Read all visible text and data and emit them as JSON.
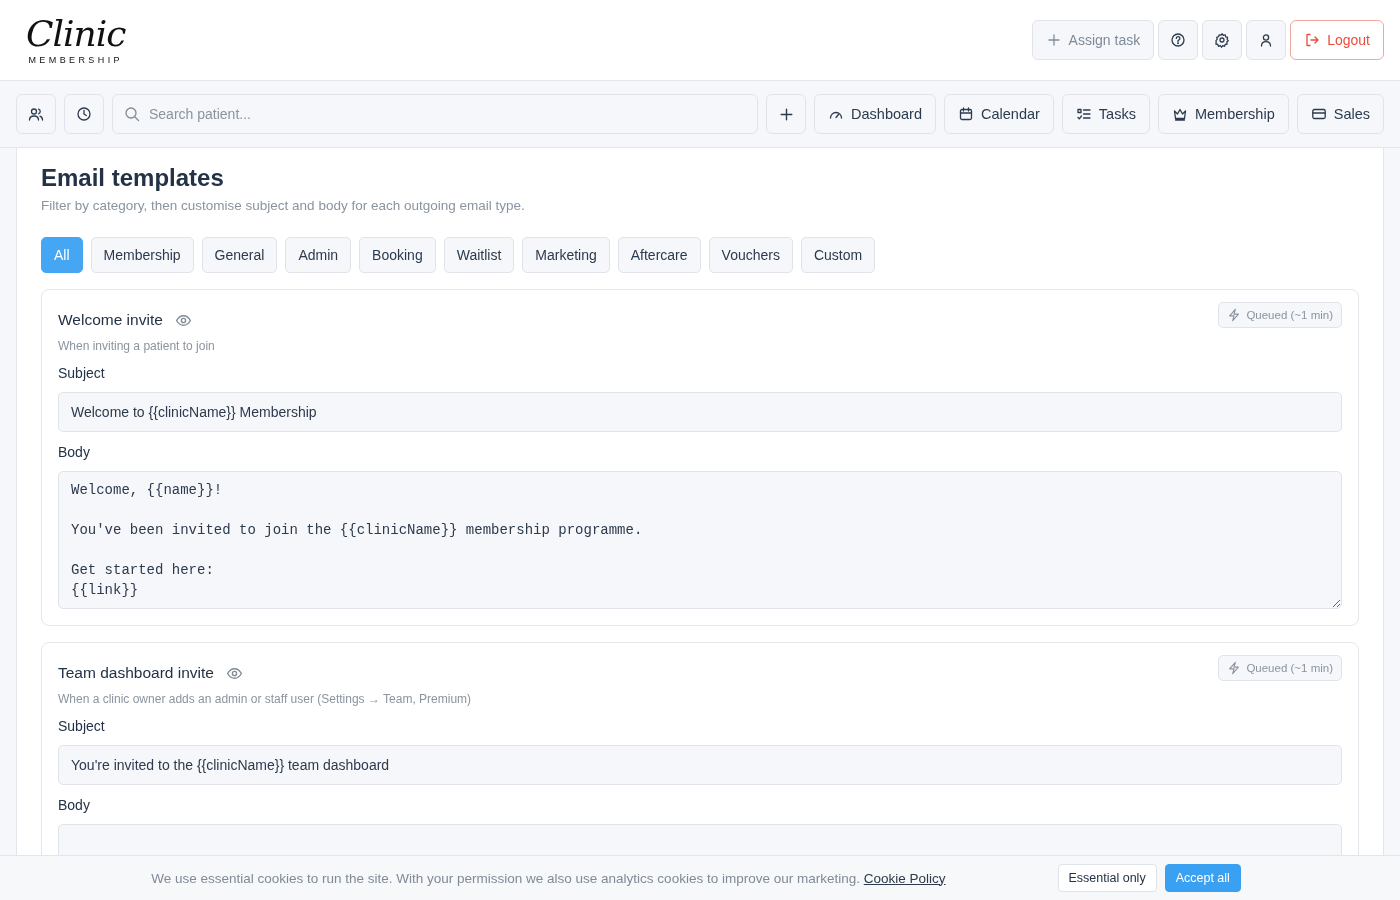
{
  "header": {
    "logo": {
      "script": "Clinic",
      "tagline": "MEMBERSHIP"
    },
    "actions": [
      {
        "kind": "assign",
        "label": "Assign task"
      },
      {
        "kind": "help"
      },
      {
        "kind": "settings"
      },
      {
        "kind": "account"
      },
      {
        "kind": "logout",
        "label": "Logout"
      }
    ]
  },
  "toolbar": {
    "left": [
      {
        "kind": "patients"
      },
      {
        "kind": "history"
      }
    ],
    "search": {
      "placeholder": "Search patient..."
    },
    "add": {
      "kind": "add"
    },
    "nav": [
      {
        "kind": "dashboard",
        "label": "Dashboard"
      },
      {
        "kind": "calendar",
        "label": "Calendar"
      },
      {
        "kind": "tasks",
        "label": "Tasks"
      },
      {
        "kind": "membership",
        "label": "Membership"
      },
      {
        "kind": "sales",
        "label": "Sales"
      }
    ]
  },
  "page": {
    "title": "Email templates",
    "subtitle": "Filter by category, then customise subject and body for each outgoing email type.",
    "filters": [
      {
        "label": "All",
        "selected": true
      },
      {
        "label": "Membership",
        "selected": false
      },
      {
        "label": "General",
        "selected": false
      },
      {
        "label": "Admin",
        "selected": false
      },
      {
        "label": "Booking",
        "selected": false
      },
      {
        "label": "Waitlist",
        "selected": false
      },
      {
        "label": "Marketing",
        "selected": false
      },
      {
        "label": "Aftercare",
        "selected": false
      },
      {
        "label": "Vouchers",
        "selected": false
      },
      {
        "label": "Custom",
        "selected": false
      }
    ],
    "templates": [
      {
        "name": "Welcome invite",
        "description": "When inviting a patient to join",
        "status": "Queued (~1 min)",
        "subject_label": "Subject",
        "subject": "Welcome to {{clinicName}} Membership",
        "body_label": "Body",
        "body": "Welcome, {{name}}!\n\nYou've been invited to join the {{clinicName}} membership programme.\n\nGet started here:\n{{link}}"
      },
      {
        "name": "Team dashboard invite",
        "description": "When a clinic owner adds an admin or staff user (Settings → Team, Premium)",
        "status": "Queued (~1 min)",
        "subject_label": "Subject",
        "subject": "You're invited to the {{clinicName}} team dashboard",
        "body_label": "Body"
      }
    ]
  },
  "cookie_banner": {
    "text": "We use essential cookies to run the site. With your permission we also use analytics cookies to improve our marketing.",
    "link": "Cookie Policy",
    "buttons": [
      {
        "kind": "secondary",
        "label": "Essential only"
      },
      {
        "kind": "primary",
        "label": "Accept all"
      }
    ]
  }
}
